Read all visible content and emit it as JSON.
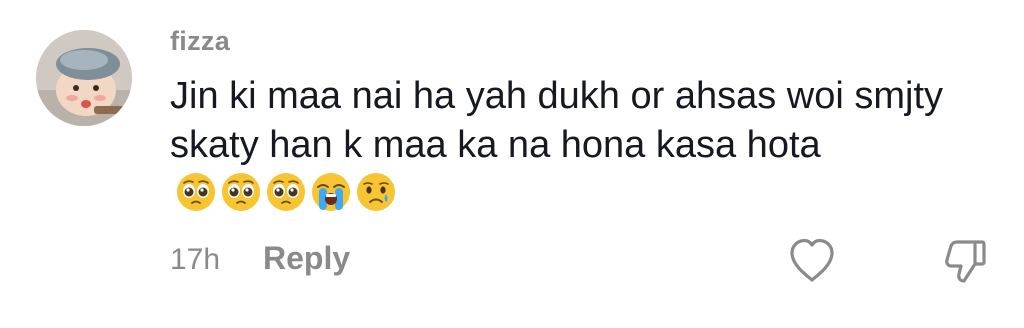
{
  "comment": {
    "username": "fizza",
    "text": "Jin ki maa nai ha yah dukh or ahsas woi smjty skaty han k maa ka na hona kasa hota",
    "emojis": [
      "pleading-face",
      "pleading-face",
      "pleading-face",
      "loudly-crying-face",
      "crying-face"
    ],
    "timestamp": "17h",
    "reply_label": "Reply"
  },
  "icons": {
    "like": "heart-outline-icon",
    "dislike": "thumbs-down-outline-icon"
  },
  "colors": {
    "text": "#161823",
    "muted": "#8a8a8a",
    "emoji_yellow": "#f7c531",
    "tear_blue": "#3fa9f5"
  }
}
